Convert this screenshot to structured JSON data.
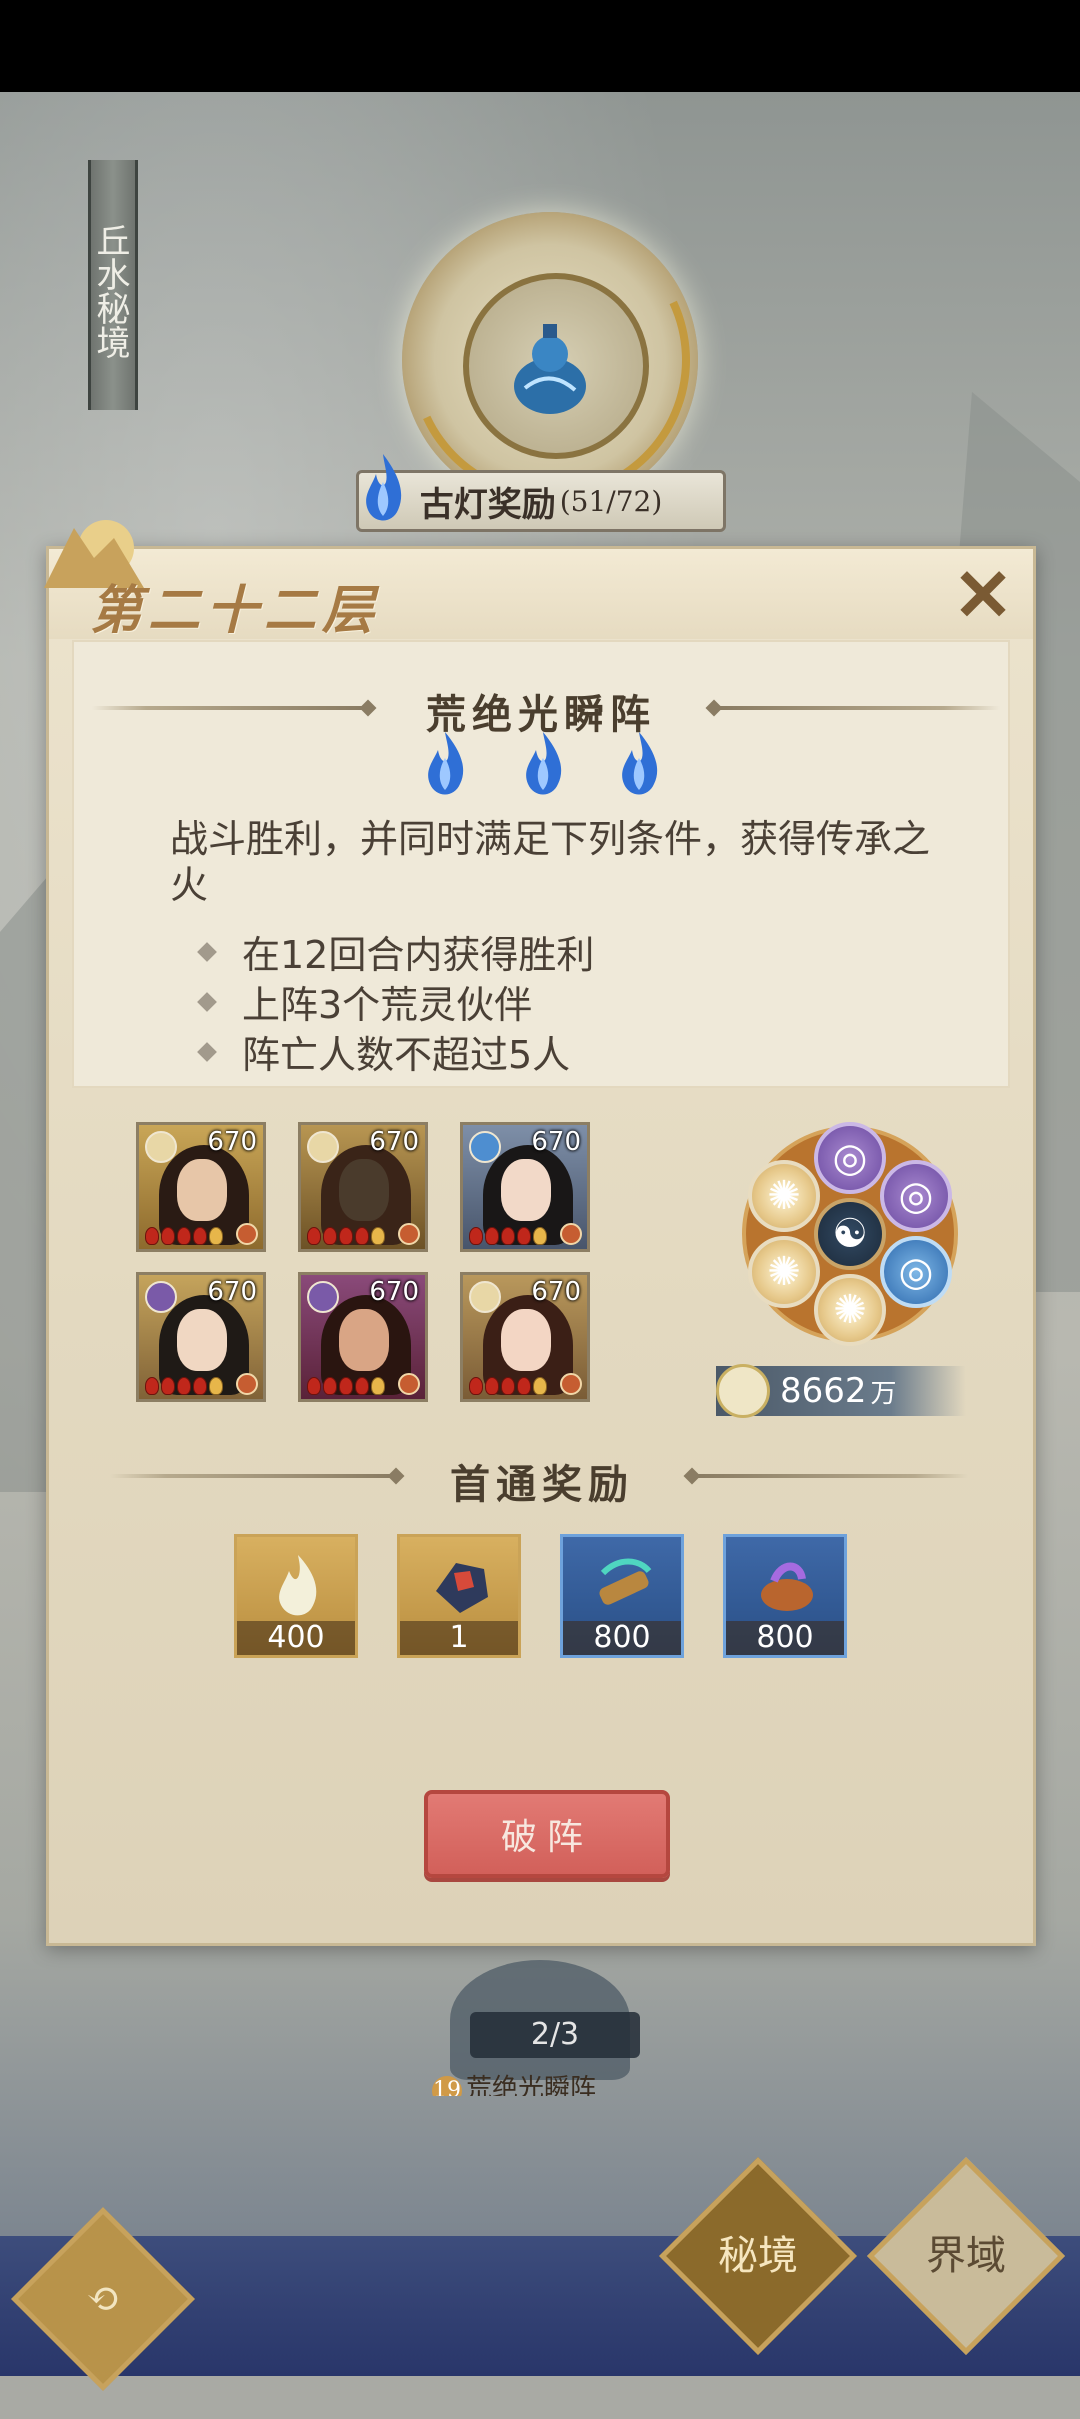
{
  "region_title": "丘水秘境",
  "lamp_reward": {
    "label": "古灯奖励",
    "count": "(51/72)"
  },
  "modal": {
    "floor_title": "第二十二层",
    "close_label": "✕",
    "formation_name": "荒绝光瞬阵",
    "description": "战斗胜利，并同时满足下列条件，获得传承之火",
    "conditions": [
      "在12回合内获得胜利",
      "上阵3个荒灵伙伴",
      "阵亡人数不超过5人"
    ],
    "heroes": [
      {
        "level": "670",
        "badge": "gold"
      },
      {
        "level": "670",
        "badge": "gold"
      },
      {
        "level": "670",
        "badge": "blue"
      },
      {
        "level": "670",
        "badge": "purple"
      },
      {
        "level": "670",
        "badge": "purple"
      },
      {
        "level": "670",
        "badge": "gold"
      }
    ],
    "power": {
      "value": "8662",
      "unit": "万"
    },
    "first_clear_title": "首通奖励",
    "rewards": [
      {
        "qty": "400",
        "frame": "gold"
      },
      {
        "qty": "1",
        "frame": "gold"
      },
      {
        "qty": "800",
        "frame": "blue"
      },
      {
        "qty": "800",
        "frame": "blue"
      }
    ],
    "break_button": "破阵"
  },
  "node_progress": "2/3",
  "node_label": {
    "num": "19",
    "name": "荒绝光瞬阵"
  },
  "bottom_nav": {
    "secret_realm": "秘境",
    "realm": "界域"
  },
  "colors": {
    "title": "#a67a44",
    "button": "#d2605a",
    "flame": "#2f6fd6"
  }
}
